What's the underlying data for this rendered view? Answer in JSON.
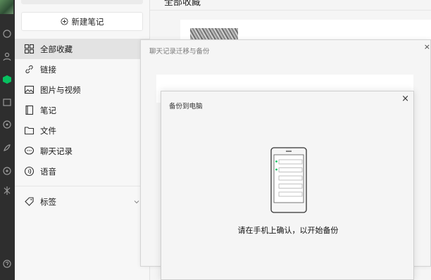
{
  "sidebar": {
    "new_note_label": "新建笔记",
    "items": [
      {
        "label": "全部收藏",
        "icon": "grid-icon"
      },
      {
        "label": "链接",
        "icon": "link-icon"
      },
      {
        "label": "图片与视频",
        "icon": "image-icon"
      },
      {
        "label": "笔记",
        "icon": "note-icon"
      },
      {
        "label": "文件",
        "icon": "folder-icon"
      },
      {
        "label": "聊天记录",
        "icon": "chat-icon"
      },
      {
        "label": "语音",
        "icon": "voice-icon"
      }
    ],
    "tags_label": "标签"
  },
  "main": {
    "header_title": "全部收藏"
  },
  "migrate_dialog": {
    "title": "聊天记录迁移与备份",
    "close": "×"
  },
  "backup_dialog": {
    "title": "备份到电脑",
    "close": "×",
    "message": "请在手机上确认，以开始备份"
  },
  "colors": {
    "accent_green": "#07c160",
    "rail_dark": "#2e2e2e"
  }
}
